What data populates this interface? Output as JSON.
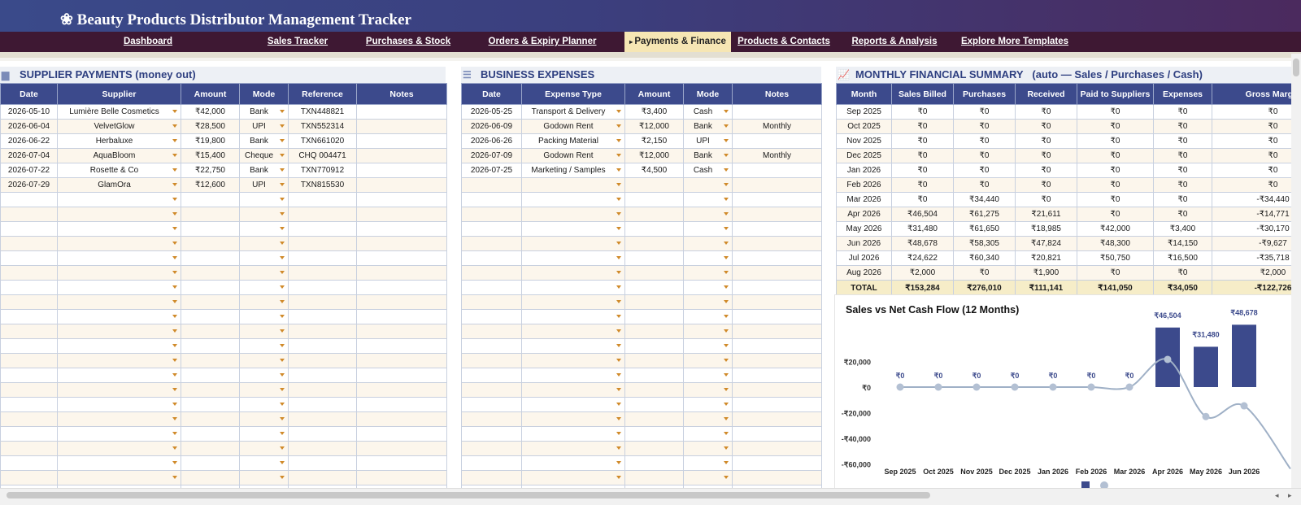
{
  "app": {
    "title": "Beauty Products Distributor Management Tracker",
    "logo_icon": "flower-icon"
  },
  "nav": {
    "active_index": 4,
    "items": [
      {
        "label": "Dashboard"
      },
      {
        "label": "Sales Tracker"
      },
      {
        "label": "Purchases & Stock"
      },
      {
        "label": "Orders & Expiry Planner"
      },
      {
        "label": "Payments & Finance",
        "marker": "▸"
      },
      {
        "label": "Products & Contacts"
      },
      {
        "label": "Reports & Analysis"
      },
      {
        "label": "Explore More Templates"
      }
    ]
  },
  "supplier_payments": {
    "title": "SUPPLIER PAYMENTS (money out)",
    "icon": "bar-chart-icon",
    "columns": [
      "Date",
      "Supplier",
      "Amount",
      "Mode",
      "Reference",
      "Notes"
    ],
    "rows": [
      [
        "2026-05-10",
        "Lumière Belle Cosmetics",
        "₹42,000",
        "Bank",
        "TXN448821",
        ""
      ],
      [
        "2026-06-04",
        "VelvetGlow",
        "₹28,500",
        "UPI",
        "TXN552314",
        ""
      ],
      [
        "2026-06-22",
        "Herbaluxe",
        "₹19,800",
        "Bank",
        "TXN661020",
        ""
      ],
      [
        "2026-07-04",
        "AquaBloom",
        "₹15,400",
        "Cheque",
        "CHQ 004471",
        ""
      ],
      [
        "2026-07-22",
        "Rosette & Co",
        "₹22,750",
        "Bank",
        "TXN770912",
        ""
      ],
      [
        "2026-07-29",
        "GlamOra",
        "₹12,600",
        "UPI",
        "TXN815530",
        ""
      ]
    ]
  },
  "business_expenses": {
    "title": "BUSINESS EXPENSES",
    "icon": "document-icon",
    "columns": [
      "Date",
      "Expense Type",
      "Amount",
      "Mode",
      "Notes"
    ],
    "rows": [
      [
        "2026-05-25",
        "Transport & Delivery",
        "₹3,400",
        "Cash",
        ""
      ],
      [
        "2026-06-09",
        "Godown Rent",
        "₹12,000",
        "Bank",
        "Monthly"
      ],
      [
        "2026-06-26",
        "Packing Material",
        "₹2,150",
        "UPI",
        ""
      ],
      [
        "2026-07-09",
        "Godown Rent",
        "₹12,000",
        "Bank",
        "Monthly"
      ],
      [
        "2026-07-25",
        "Marketing / Samples",
        "₹4,500",
        "Cash",
        ""
      ]
    ]
  },
  "monthly_summary": {
    "title": "MONTHLY FINANCIAL SUMMARY",
    "subtitle": "(auto — Sales / Purchases / Cash)",
    "icon": "line-chart-icon",
    "columns": [
      "Month",
      "Sales Billed",
      "Purchases",
      "Received",
      "Paid to Suppliers",
      "Expenses",
      "Gross Margin"
    ],
    "rows": [
      [
        "Sep 2025",
        "₹0",
        "₹0",
        "₹0",
        "₹0",
        "₹0",
        "₹0"
      ],
      [
        "Oct 2025",
        "₹0",
        "₹0",
        "₹0",
        "₹0",
        "₹0",
        "₹0"
      ],
      [
        "Nov 2025",
        "₹0",
        "₹0",
        "₹0",
        "₹0",
        "₹0",
        "₹0"
      ],
      [
        "Dec 2025",
        "₹0",
        "₹0",
        "₹0",
        "₹0",
        "₹0",
        "₹0"
      ],
      [
        "Jan 2026",
        "₹0",
        "₹0",
        "₹0",
        "₹0",
        "₹0",
        "₹0"
      ],
      [
        "Feb 2026",
        "₹0",
        "₹0",
        "₹0",
        "₹0",
        "₹0",
        "₹0"
      ],
      [
        "Mar 2026",
        "₹0",
        "₹34,440",
        "₹0",
        "₹0",
        "₹0",
        "-₹34,440"
      ],
      [
        "Apr 2026",
        "₹46,504",
        "₹61,275",
        "₹21,611",
        "₹0",
        "₹0",
        "-₹14,771"
      ],
      [
        "May 2026",
        "₹31,480",
        "₹61,650",
        "₹18,985",
        "₹42,000",
        "₹3,400",
        "-₹30,170"
      ],
      [
        "Jun 2026",
        "₹48,678",
        "₹58,305",
        "₹47,824",
        "₹48,300",
        "₹14,150",
        "-₹9,627"
      ],
      [
        "Jul 2026",
        "₹24,622",
        "₹60,340",
        "₹20,821",
        "₹50,750",
        "₹16,500",
        "-₹35,718"
      ],
      [
        "Aug 2026",
        "₹2,000",
        "₹0",
        "₹1,900",
        "₹0",
        "₹0",
        "₹2,000"
      ]
    ],
    "total": [
      "TOTAL",
      "₹153,284",
      "₹276,010",
      "₹111,141",
      "₹141,050",
      "₹34,050",
      "-₹122,726"
    ]
  },
  "chart_data": {
    "type": "bar",
    "title": "Sales vs Net Cash Flow (12 Months)",
    "categories": [
      "Sep 2025",
      "Oct 2025",
      "Nov 2025",
      "Dec 2025",
      "Jan 2026",
      "Feb 2026",
      "Mar 2026",
      "Apr 2026",
      "May 2026",
      "Jun 2026"
    ],
    "ylim": [
      -60000,
      20000
    ],
    "yticks": [
      20000,
      0,
      -20000,
      -40000,
      -60000
    ],
    "ytick_labels": [
      "₹20,000",
      "₹0",
      "-₹20,000",
      "-₹40,000",
      "-₹60,000"
    ],
    "series": [
      {
        "values": [
          0,
          0,
          0,
          0,
          0,
          0,
          0,
          46504,
          31480,
          48678
        ],
        "labels": [
          "₹0",
          "₹0",
          "₹0",
          "₹0",
          "₹0",
          "₹0",
          "₹0",
          "₹46,504",
          "₹31,480",
          "₹48,678"
        ],
        "color": "#3c4a8c"
      },
      {
        "values": [
          0,
          0,
          0,
          0,
          0,
          0,
          0,
          21611,
          -23015,
          -14626
        ],
        "color": "#9fb0c6"
      }
    ],
    "legend": "bottom",
    "grid": false
  },
  "colors": {
    "header_blue": "#3c4a8c",
    "nav_dark": "#3e1833",
    "active_tab": "#f6e6b4",
    "row_alt": "#fcf6ec",
    "total_row": "#f6edc8"
  }
}
